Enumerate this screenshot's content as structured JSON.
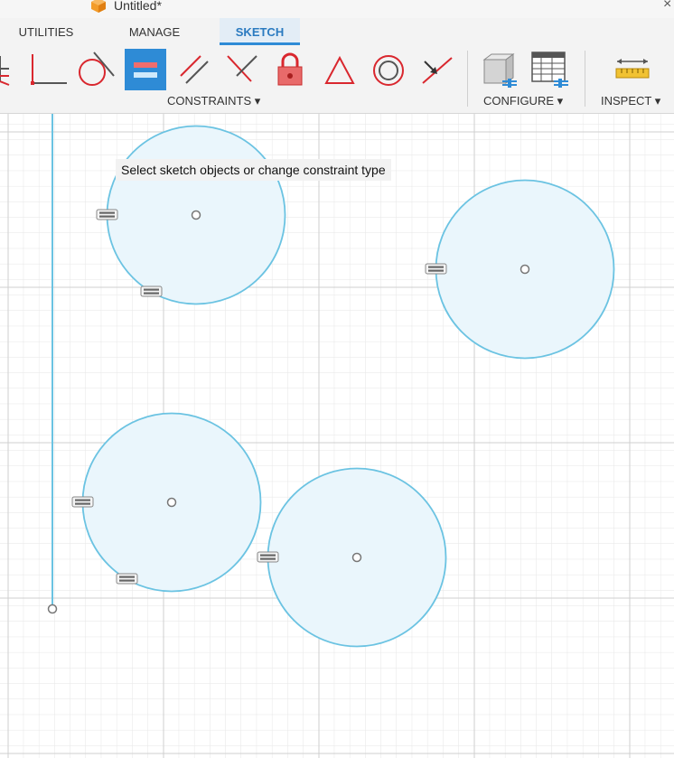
{
  "window": {
    "title": "Untitled*"
  },
  "tabs": [
    {
      "label": "UTILITIES",
      "active": false
    },
    {
      "label": "MANAGE",
      "active": false
    },
    {
      "label": "SKETCH",
      "active": true
    }
  ],
  "toolbar": {
    "constraints": {
      "label": "CONSTRAINTS ▾",
      "tools": [
        "fix-icon",
        "perpendicular-icon",
        "tangent-icon",
        "equal-icon",
        "parallel-icon",
        "perpendicular-lines-icon",
        "lock-icon",
        "triangle-icon",
        "concentric-icon",
        "coincident-icon"
      ],
      "active_tool": "equal-icon"
    },
    "configure": {
      "label": "CONFIGURE ▾",
      "tools": [
        "configure-box-icon",
        "configure-table-icon"
      ]
    },
    "inspect": {
      "label": "INSPECT ▾",
      "tools": [
        "measure-icon"
      ]
    }
  },
  "tooltip": "Select sketch objects or change constraint type",
  "colors": {
    "accent": "#2e8bd6",
    "sketch_line": "#6bc3e2",
    "circle_fill": "#eaf6fc",
    "grid_minor": "#e3e3e3",
    "grid_major": "#cdcdcd",
    "constraint_red": "#d9272e"
  },
  "sketch": {
    "circles": [
      {
        "name": "circle-1",
        "constraints": 2
      },
      {
        "name": "circle-2",
        "constraints": 1
      },
      {
        "name": "circle-3",
        "constraints": 2
      },
      {
        "name": "circle-4",
        "constraints": 1
      }
    ]
  }
}
